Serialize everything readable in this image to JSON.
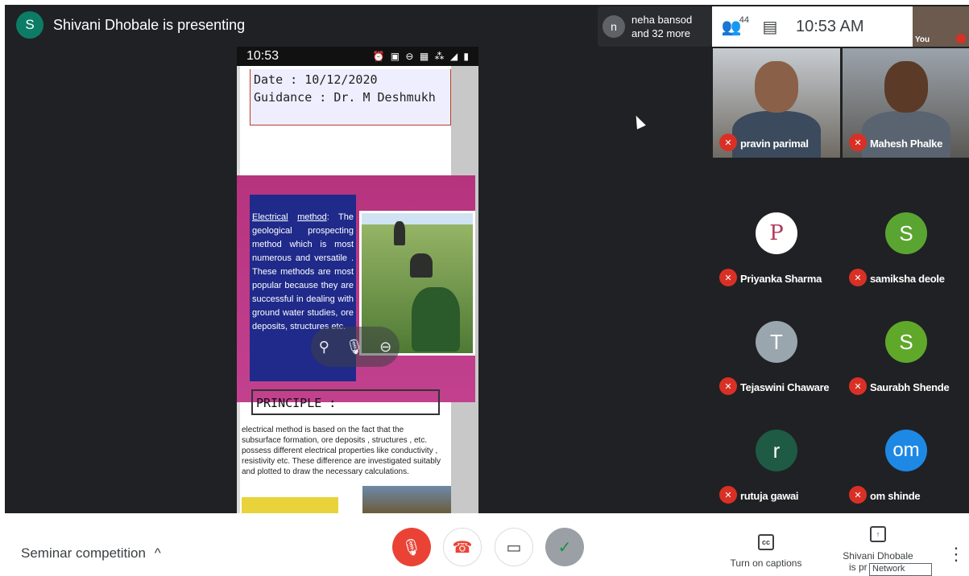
{
  "top": {
    "presenter_initial": "S",
    "presenter_text": "Shivani Dhobale is presenting",
    "others_initial": "n",
    "others_line1": "neha bansod",
    "others_line2": "and 32 more",
    "people_count": "44",
    "time": "10:53 AM",
    "self_label": "You"
  },
  "phone": {
    "status_time": "10:53",
    "status_icons": "⏰ ▣ ⊖ ▦ ⁂ ◢ ▮",
    "date_line": "Date  :   10/12/2020",
    "guidance_line": "Guidance : Dr. M  Deshmukh",
    "slide_text_lead1": "Electrical",
    "slide_text_lead2": "method",
    "slide_text_body": ": The geological prospecting method which is most numerous and versatile . These methods are most popular because they are successful in dealing with ground water studies, ore deposits, structures etc.",
    "principle_title": "PRINCIPLE :",
    "principle_text": "electrical method is based on the fact that the subsurface formation, ore deposits , structures , etc. possess different electrical properties like conductivity , resistivity etc. These difference are investigated suitably and plotted to draw the necessary calculations."
  },
  "participants": [
    {
      "name": "pravin parimal",
      "type": "video"
    },
    {
      "name": "Mahesh Phalke",
      "type": "video"
    },
    {
      "name": "Priyanka Sharma",
      "initial": "P",
      "color": "#ffffff"
    },
    {
      "name": "samiksha deole",
      "initial": "S",
      "color": "#4caf50"
    },
    {
      "name": "Tejaswini Chaware",
      "initial": "T",
      "color": "#9aa6ad"
    },
    {
      "name": "Saurabh Shende",
      "initial": "S",
      "color": "#5fa82a"
    },
    {
      "name": "rutuja gawai",
      "initial": "r",
      "color": "#1e5a44"
    },
    {
      "name": "om shinde",
      "initial": "om",
      "color": "#1e88e5"
    }
  ],
  "bottom": {
    "meeting_name": "Seminar competition",
    "caret": "^",
    "captions_label": "Turn on captions",
    "present_label_1": "Shivani Dhobale",
    "present_label_2": "is pr",
    "tooltip": "Network",
    "captions_icon": "cc",
    "menu_glyph": "⋮"
  },
  "colors": {
    "end_call": "#ea4335",
    "mic_off": "#d93025",
    "accept": "#81c995"
  }
}
